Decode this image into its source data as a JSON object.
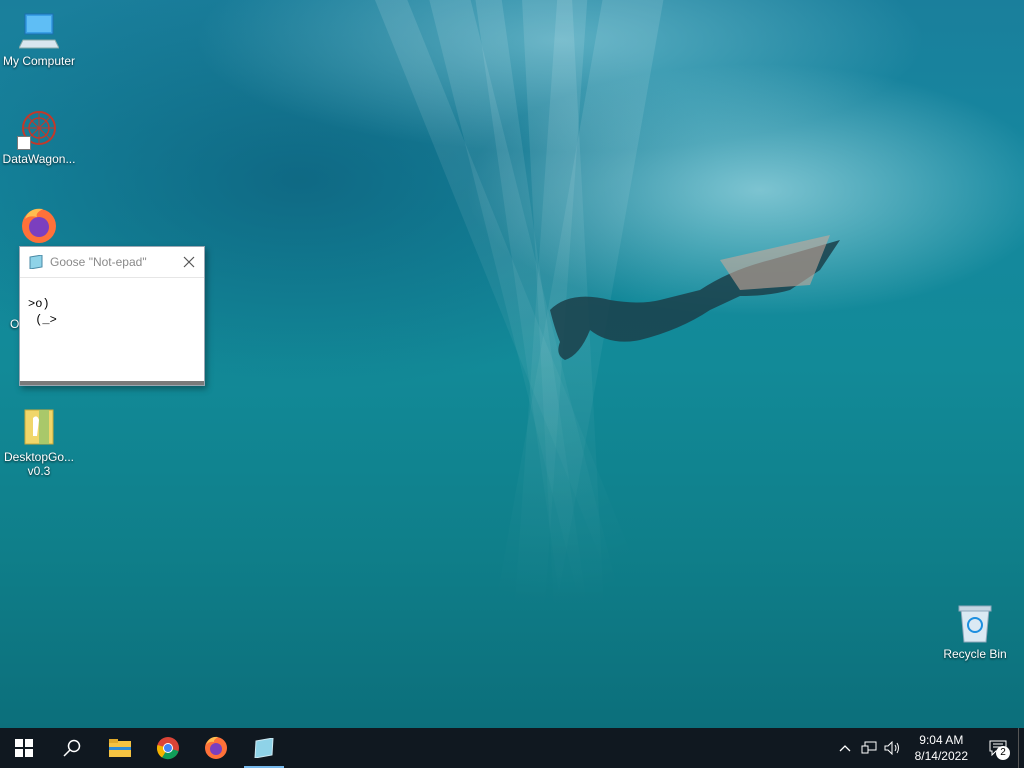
{
  "desktop": {
    "icons": [
      {
        "label": "My Computer",
        "icon": "computer-icon"
      },
      {
        "label": "DataWagon...",
        "icon": "datawagon-icon"
      },
      {
        "label": "O",
        "icon": "firefox-icon"
      },
      {
        "label": "DesktopGo... v0.3",
        "icon": "folder-icon"
      },
      {
        "label": "Recycle Bin",
        "icon": "recycle-bin-icon"
      }
    ]
  },
  "goose_window": {
    "title": "Goose \"Not-epad\"",
    "text": ">o)\n (_>"
  },
  "taskbar": {
    "apps": [
      {
        "icon": "windows-start-icon"
      },
      {
        "icon": "search-icon"
      },
      {
        "icon": "file-explorer-icon"
      },
      {
        "icon": "chrome-icon"
      },
      {
        "icon": "firefox-icon"
      },
      {
        "icon": "notepad-icon"
      }
    ],
    "clock_time": "9:04 AM",
    "clock_date": "8/14/2022",
    "notification_count": "2",
    "accent": "#76b9ed"
  }
}
